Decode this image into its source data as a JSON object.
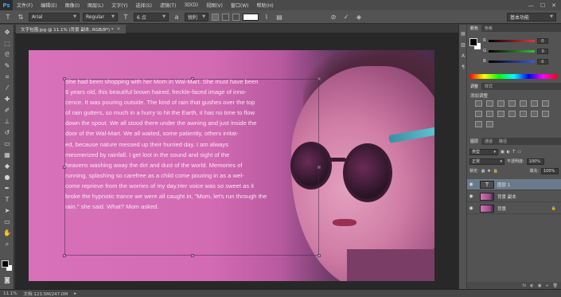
{
  "app": {
    "logo": "Ps"
  },
  "menu": [
    "文件(F)",
    "编辑(E)",
    "图像(I)",
    "图层(L)",
    "文字(Y)",
    "选择(S)",
    "滤镜(T)",
    "3D(D)",
    "视图(V)",
    "窗口(W)",
    "帮助(H)"
  ],
  "window_controls": {
    "minimize": "—",
    "maximize": "☐",
    "close": "✕"
  },
  "options": {
    "font_family": "Arial",
    "font_style": "Regular",
    "font_size": "6 点",
    "antialias": "锐利",
    "text_color": "#ffffff",
    "workspace": "基本功能"
  },
  "document": {
    "tab_label": "文字包围.jpg @ 11.1% (背景 副本, RGB/8*) *",
    "close": "×"
  },
  "paragraph": [
    "She had been shopping with her Mom in Wal-Mart. She must have been",
    "6 years old, this beautiful brown haired, freckle-faced image of inno-",
    "cence. It was pouring outside. The kind of rain that gushes over the top",
    "of rain gutters, so much in a hurry to hit the Earth, it has no time to flow",
    "down the spout. We all stood there under the awning and just inside the",
    "door of the Wal-Mart. We all waited, some patiently, others irritat-",
    "ed, because nature messed up their hurried day. I am always",
    "mesmerized by rainfall. I get lost in the sound and sight of the",
    "heavens washing away the dirt and dust of the world. Memories of",
    "running, splashing so carefree as a child come pouring in as a wel-",
    "come reprieve from the worries of my day.Her voice was so sweet as it",
    "broke the hypnotic trance we were all caught in, \"Mom, let's run through the",
    "rain.\" she said. What? Mom asked."
  ],
  "status": {
    "zoom": "11.1%",
    "doc_info": "文档:123.5M/247.0M",
    "arrow": "▸"
  },
  "color_panel": {
    "tabs": [
      "颜色",
      "色板"
    ],
    "channels": [
      {
        "label": "R",
        "value": "0",
        "color": "#e03a3a"
      },
      {
        "label": "G",
        "value": "0",
        "color": "#3ac03a"
      },
      {
        "label": "B",
        "value": "0",
        "color": "#3a5ae0"
      }
    ]
  },
  "adjust_panel": {
    "tabs": [
      "调整",
      "样式"
    ],
    "title": "添加调整"
  },
  "layers_panel": {
    "tabs": [
      "图层",
      "通道",
      "路径"
    ],
    "filter": "类型",
    "blend_mode": "正常",
    "opacity_label": "不透明度:",
    "opacity": "100%",
    "lock_label": "锁定:",
    "fill_label": "填充:",
    "fill": "100%",
    "layers": [
      {
        "name": "图层 1",
        "thumb": "T",
        "selected": true
      },
      {
        "name": "背景 副本",
        "thumb": "",
        "selected": false
      },
      {
        "name": "背景",
        "thumb": "",
        "selected": false,
        "locked": "🔒"
      }
    ],
    "footer_icons": [
      "fx",
      "◐",
      "▣",
      "+",
      "🗑"
    ]
  }
}
